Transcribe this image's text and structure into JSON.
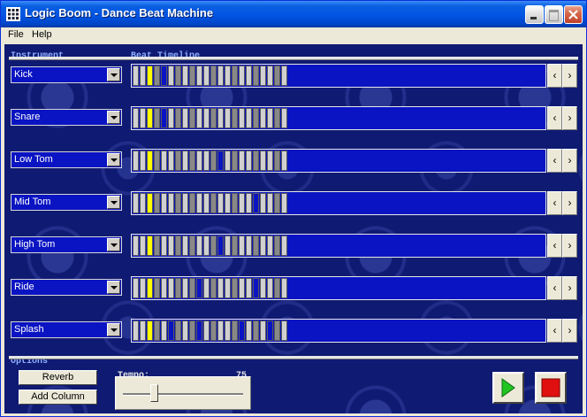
{
  "window": {
    "title": "Logic Boom - Dance Beat Machine",
    "icon": "grid-app-icon"
  },
  "menubar": [
    "File",
    "Help"
  ],
  "headers": {
    "instrument": "Instrument",
    "timeline": "Beat Timeline",
    "options": "Options"
  },
  "rows": [
    {
      "instrument": "Kick",
      "pattern": "wwygbwgwgwwgwwgwwgwwgw"
    },
    {
      "instrument": "Snare",
      "pattern": "wwygbwgwgwwgwwgwwgwwgw"
    },
    {
      "instrument": "Low Tom",
      "pattern": "wwygwwgwgwwgbwgwwgwwgw"
    },
    {
      "instrument": "Mid Tom",
      "pattern": "wwygwwgwgwwgwwgwwbwwgw"
    },
    {
      "instrument": "High Tom",
      "pattern": "wwygwwgwgwwgbwgwwgwwgw"
    },
    {
      "instrument": "Ride",
      "pattern": "wwygwwgwgbwgwwgwwbwwgw"
    },
    {
      "instrument": "Splash",
      "pattern": "wwygwbgwgbwgwwgbwgwbgw"
    }
  ],
  "controls": {
    "reverb_label": "Reverb",
    "add_column_label": "Add Column",
    "tempo_label": "Tempo:",
    "tempo_value": "75",
    "tempo_fraction": 0.26,
    "play_icon": "play-icon",
    "stop_icon": "stop-icon"
  },
  "colors": {
    "panel_blue": "#0a14c2",
    "active_beat": "#ffff00",
    "play": "#22c422",
    "stop": "#e01010"
  }
}
